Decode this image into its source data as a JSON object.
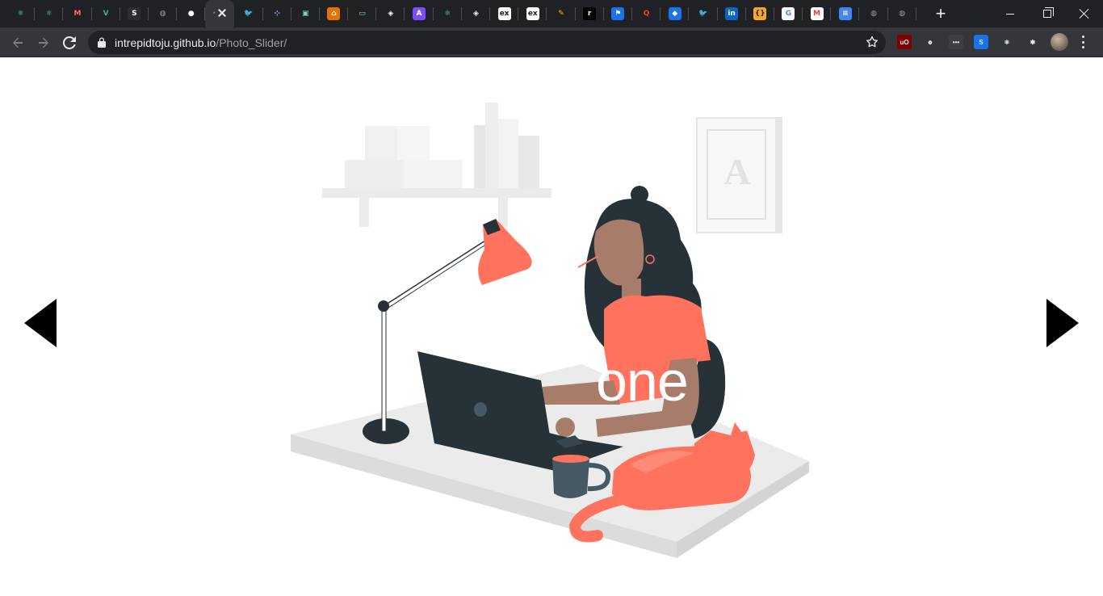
{
  "browser": {
    "tabs": [
      {
        "icon": "react-icon",
        "glyph": "⚛",
        "color": "#61dafb",
        "bg": "transparent"
      },
      {
        "icon": "react-icon",
        "glyph": "⚛",
        "color": "#4fd1c5",
        "bg": "transparent"
      },
      {
        "icon": "m-logo-icon",
        "glyph": "M",
        "color": "#ff6b6b",
        "bg": "transparent"
      },
      {
        "icon": "vue-icon",
        "glyph": "V",
        "color": "#41b883",
        "bg": "transparent"
      },
      {
        "icon": "s-logo-icon",
        "glyph": "S",
        "color": "#ffffff",
        "bg": "#2b2d31"
      },
      {
        "icon": "globe-icon",
        "glyph": "◍",
        "color": "#9aa0a6",
        "bg": "transparent"
      },
      {
        "icon": "github-icon",
        "glyph": "●",
        "color": "#ffffff",
        "bg": "transparent"
      },
      {
        "icon": "active-tab-icon",
        "glyph": "·",
        "color": "#9aa0a6",
        "bg": "transparent"
      },
      {
        "icon": "twitter-icon",
        "glyph": "🐦",
        "color": "#1da1f2",
        "bg": "transparent"
      },
      {
        "icon": "antenna-icon",
        "glyph": "⊹",
        "color": "#8ab4f8",
        "bg": "transparent"
      },
      {
        "icon": "image-icon",
        "glyph": "▣",
        "color": "#7dd3c0",
        "bg": "transparent"
      },
      {
        "icon": "scholar-icon",
        "glyph": "⌂",
        "color": "#ffffff",
        "bg": "#e37400"
      },
      {
        "icon": "terminal-icon",
        "glyph": "▭",
        "color": "#7ee787",
        "bg": "#202124"
      },
      {
        "icon": "codepen-icon",
        "glyph": "◈",
        "color": "#ffffff",
        "bg": "transparent"
      },
      {
        "icon": "a-logo-icon",
        "glyph": "A",
        "color": "#ffffff",
        "bg": "#7c4dff"
      },
      {
        "icon": "react-icon",
        "glyph": "⚛",
        "color": "#61dafb",
        "bg": "transparent"
      },
      {
        "icon": "codepen-icon",
        "glyph": "◈",
        "color": "#ffffff",
        "bg": "transparent"
      },
      {
        "icon": "ex-icon",
        "glyph": "ex",
        "color": "#202124",
        "bg": "#ffffff"
      },
      {
        "icon": "ex-icon",
        "glyph": "ex",
        "color": "#202124",
        "bg": "#ffffff"
      },
      {
        "icon": "pencil-icon",
        "glyph": "✎",
        "color": "#fbbc04",
        "bg": "transparent"
      },
      {
        "icon": "r-logo-icon",
        "glyph": "r",
        "color": "#ffffff",
        "bg": "#000000"
      },
      {
        "icon": "flag-icon",
        "glyph": "⚑",
        "color": "#ffffff",
        "bg": "#1a73e8"
      },
      {
        "icon": "q-logo-icon",
        "glyph": "Q",
        "color": "#ea4335",
        "bg": "transparent"
      },
      {
        "icon": "diamond-icon",
        "glyph": "◆",
        "color": "#ffffff",
        "bg": "#1a73e8"
      },
      {
        "icon": "twitter-icon",
        "glyph": "🐦",
        "color": "#1da1f2",
        "bg": "transparent"
      },
      {
        "icon": "linkedin-icon",
        "glyph": "in",
        "color": "#ffffff",
        "bg": "#0a66c2"
      },
      {
        "icon": "bracket-icon",
        "glyph": "{}",
        "color": "#202124",
        "bg": "#f9a825"
      },
      {
        "icon": "google-icon",
        "glyph": "G",
        "color": "#4285f4",
        "bg": "#ffffff"
      },
      {
        "icon": "gmail-icon",
        "glyph": "M",
        "color": "#ea4335",
        "bg": "#ffffff"
      },
      {
        "icon": "docs-icon",
        "glyph": "≡",
        "color": "#ffffff",
        "bg": "#4285f4"
      },
      {
        "icon": "globe-icon",
        "glyph": "◍",
        "color": "#9aa0a6",
        "bg": "transparent"
      },
      {
        "icon": "globe-icon",
        "glyph": "◍",
        "color": "#9aa0a6",
        "bg": "transparent"
      }
    ],
    "active_tab_index": 7,
    "address": {
      "host": "intrepidtoju.github.io",
      "path": "/Photo_Slider/"
    },
    "extensions": [
      {
        "icon": "ublock-icon",
        "glyph": "uO",
        "bg": "#800000"
      },
      {
        "icon": "mask-icon",
        "glyph": "☻",
        "bg": "transparent"
      },
      {
        "icon": "dots-ext-icon",
        "glyph": "•••",
        "bg": "#3c4043"
      },
      {
        "icon": "s-ext-icon",
        "glyph": "S",
        "bg": "#1a73e8"
      },
      {
        "icon": "react-devtools-icon",
        "glyph": "⚛",
        "bg": "transparent"
      },
      {
        "icon": "puzzle-icon",
        "glyph": "✱",
        "bg": "transparent"
      }
    ]
  },
  "slider": {
    "caption": "one",
    "colors": {
      "accent": "#ff725e",
      "dark": "#263238",
      "light_gray": "#ebebeb",
      "skin": "#a87c6a"
    }
  }
}
